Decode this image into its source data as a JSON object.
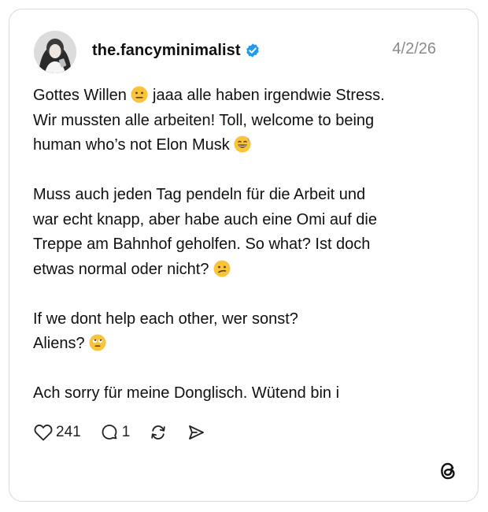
{
  "post": {
    "username": "the.fancyminimalist",
    "date": "4/2/26",
    "lines": {
      "p1l1a": "Gottes Willen ",
      "p1l1b": " jaaa alle haben irgendwie Stress.",
      "p1l2": "Wir mussten alle arbeiten! Toll, welcome to being",
      "p1l3": "human who’s not Elon Musk ",
      "p2l1": "Muss auch jeden Tag pendeln für die Arbeit und",
      "p2l2": "war echt knapp, aber habe auch eine Omi auf die",
      "p2l3": "Treppe am Bahnhof geholfen. So what? Ist doch",
      "p2l4": "etwas normal oder nicht? ",
      "p3l1": "If we dont help each other, wer sonst?",
      "p3l2": "Aliens? ",
      "p4l1": "Ach sorry für meine Donglisch. Wütend bin i"
    }
  },
  "actions": {
    "likes": "241",
    "replies": "1"
  },
  "icons": {
    "avatar": "user-avatar-photo",
    "verified": "verified-badge-icon",
    "like": "heart-icon",
    "reply": "comment-bubble-icon",
    "repost": "repost-icon",
    "share": "send-icon",
    "brand": "threads-logo-icon",
    "emoji1": "neutral-face-emoji",
    "emoji2": "grinning-sweat-emoji",
    "emoji3": "confused-face-emoji",
    "emoji4": "eye-roll-emoji"
  },
  "colors": {
    "verified": "#1d9bf0",
    "emoji": "#f9c43a",
    "muted": "#8a8a8a"
  }
}
